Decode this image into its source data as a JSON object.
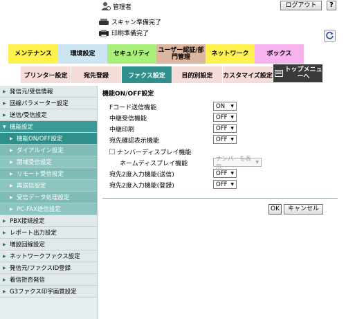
{
  "header": {
    "user_label": "管理者",
    "logout_label": "ログアウト",
    "help_label": "?"
  },
  "status": {
    "scan_text": "スキャン準備完了",
    "print_text": "印刷準備完了"
  },
  "main_tabs": [
    {
      "label": "メンテナンス"
    },
    {
      "label": "環境設定"
    },
    {
      "label": "セキュリティ"
    },
    {
      "label": "ユーザー認証/部門管理"
    },
    {
      "label": "ネットワーク"
    },
    {
      "label": "ボックス"
    }
  ],
  "sub_tabs": [
    {
      "label": "プリンター設定"
    },
    {
      "label": "宛先登録"
    },
    {
      "label": "ファクス設定"
    },
    {
      "label": "目的別設定"
    },
    {
      "label": "カスタマイズ設定"
    },
    {
      "label": "トップメニューへ"
    }
  ],
  "sidebar": {
    "items": [
      {
        "label": "発信元/受信情報"
      },
      {
        "label": "回線パラメーター設定"
      },
      {
        "label": "送信/受信設定"
      },
      {
        "label": "機能設定"
      },
      {
        "label": "機能ON/OFF設定"
      },
      {
        "label": "ダイアルイン設定"
      },
      {
        "label": "閉域受信設定"
      },
      {
        "label": "リモート受信設定"
      },
      {
        "label": "再送信設定"
      },
      {
        "label": "受信データ処理設定"
      },
      {
        "label": "PC-FAX送信設定"
      },
      {
        "label": "PBX接続設定"
      },
      {
        "label": "レポート出力設定"
      },
      {
        "label": "増設回線設定"
      },
      {
        "label": "ネットワークファクス設定"
      },
      {
        "label": "発信元/ファクスID登録"
      },
      {
        "label": "着信拒否発信"
      },
      {
        "label": "G3ファクス印字画質設定"
      }
    ]
  },
  "content": {
    "title": "機能ON/OFF設定",
    "rows": [
      {
        "label": "Fコード送信機能",
        "value": "ON"
      },
      {
        "label": "中継受信機能",
        "value": "OFF"
      },
      {
        "label": "中継印刷",
        "value": "OFF"
      },
      {
        "label": "宛先確認表示機能",
        "value": "OFF"
      },
      {
        "label": "ナンバーディスプレイ機能"
      },
      {
        "label": "ネームディスプレイ機能",
        "value": "ナンバーを表示"
      },
      {
        "label": "宛先2度入力機能(送信)",
        "value": "OFF"
      },
      {
        "label": "宛先2度入力機能(登録)",
        "value": "OFF"
      }
    ],
    "ok_label": "OK",
    "cancel_label": "キャンセル"
  },
  "colors": {
    "accent": "#2f8f8a",
    "sidebar_bg": "#e7eef0",
    "tab_yellow": "#fff24e",
    "tab_green": "#a8f07a",
    "tab_blue": "#cbe6f2",
    "tab_brown": "#dcb7a0",
    "tab_pink": "#f6b3ee",
    "subtab_pink": "#f6dcd9"
  }
}
